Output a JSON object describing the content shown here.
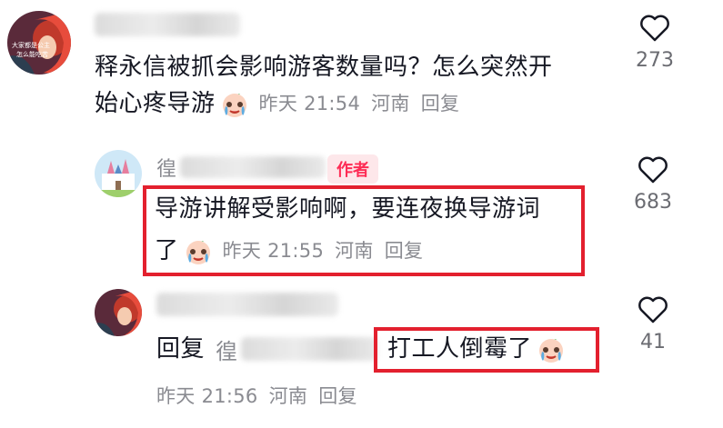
{
  "comments": [
    {
      "text": "释永信被抓会影响游客数量吗？怎么突然开",
      "text2": "始心疼导游",
      "time": "昨天 21:54",
      "location": "河南",
      "reply": "回复",
      "likes": "273"
    },
    {
      "author_name_first_char": "徨",
      "author_tag": "作者",
      "text": "导游讲解受影响啊，要连夜换导游词",
      "text2": "了",
      "time": "昨天 21:55",
      "location": "河南",
      "reply": "回复",
      "likes": "683"
    },
    {
      "reply_prefix": "回复",
      "reply_to_first_char": "徨",
      "text": "打工人倒霉了",
      "time": "昨天 21:56",
      "location": "河南",
      "reply": "回复",
      "likes": "41"
    }
  ],
  "avatar_texts": [
    "大家都是公主",
    "怎么能吃苦"
  ],
  "emoji_name": "crying-laughing-emoji",
  "colors": {
    "highlight": "#e3202e",
    "author_tag": "#fe2c55",
    "meta": "#8a8b91"
  }
}
